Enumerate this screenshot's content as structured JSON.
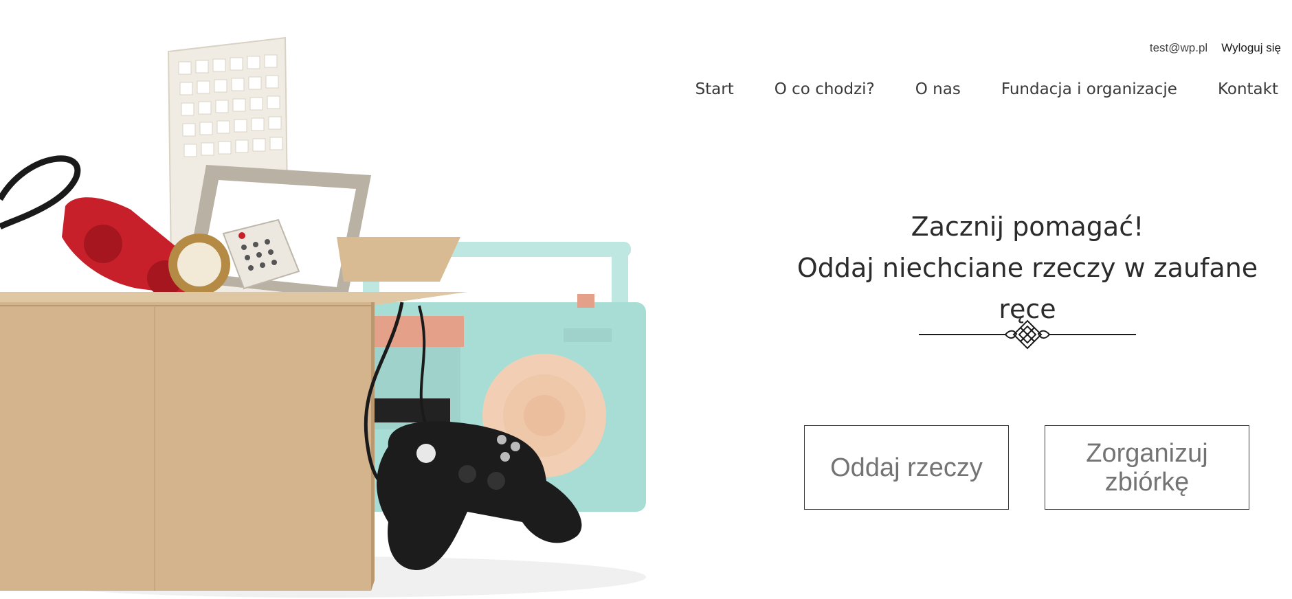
{
  "user_bar": {
    "email": "test@wp.pl",
    "logout_label": "Wyloguj się"
  },
  "nav": {
    "items": [
      {
        "label": "Start"
      },
      {
        "label": "O co chodzi?"
      },
      {
        "label": "O nas"
      },
      {
        "label": "Fundacja i organizacje"
      },
      {
        "label": "Kontakt"
      }
    ]
  },
  "hero": {
    "title": "Zacznij pomagać!",
    "subtitle": "Oddaj niechciane rzeczy w zaufane ręce",
    "image_icon": "donation-box-illustration",
    "ornament_icon": "decorative-divider-icon"
  },
  "actions": {
    "give_label": "Oddaj rzeczy",
    "organize_label": "Zorganizuj zbiórkę"
  },
  "colors": {
    "text": "#2b2b2b",
    "button_text": "#737373",
    "box": "#d4b48c",
    "radio": "#a8ddd6",
    "phone": "#c8202a"
  }
}
